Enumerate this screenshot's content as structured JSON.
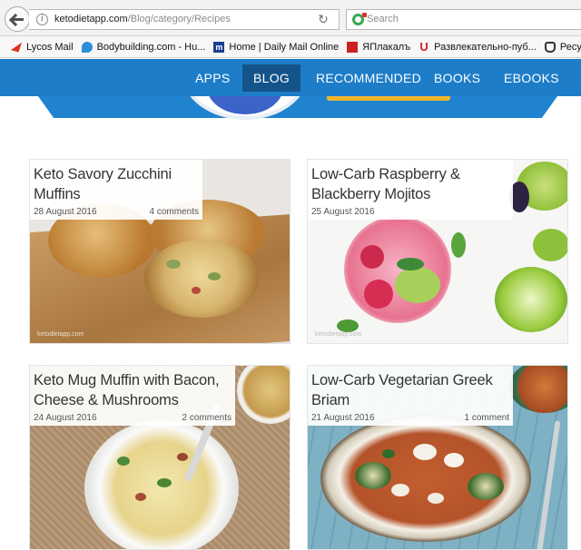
{
  "browser": {
    "url_domain": "ketodietapp.com",
    "url_path": "/Blog/category/Recipes",
    "search_placeholder": "Search",
    "bookmarks": [
      {
        "label": "Lycos Mail",
        "icon": "lycos-icon"
      },
      {
        "label": "Bodybuilding.com - Hu...",
        "icon": "bodybuilding-icon"
      },
      {
        "label": "Home | Daily Mail Online",
        "icon": "dailymail-icon"
      },
      {
        "label": "ЯПлакалъ",
        "icon": "yaplakal-icon"
      },
      {
        "label": "Развлекательно-пуб...",
        "icon": "u-icon"
      },
      {
        "label": "Ресурс Удава ",
        "icon": "hand-icon"
      }
    ]
  },
  "nav": {
    "items": [
      {
        "label": "APPS",
        "active": false
      },
      {
        "label": "BLOG",
        "active": true
      },
      {
        "label": "RECOMMENDED",
        "active": false
      },
      {
        "label": "BOOKS",
        "active": false
      },
      {
        "label": "EBOOKS",
        "active": false
      }
    ]
  },
  "colors": {
    "nav_bg": "#1d7dc8",
    "nav_active": "#14548a",
    "banner_button": "#f4b42a"
  },
  "posts": [
    {
      "title": "Keto Savory Zucchini Muffins",
      "date": "28 August 2016",
      "comments": "4 comments",
      "image": "muffins-photo"
    },
    {
      "title": "Low-Carb Raspberry & Blackberry Mojitos",
      "date": "25 August 2016",
      "comments": "",
      "image": "mojito-photo"
    },
    {
      "title": "Keto Mug Muffin with Bacon, Cheese & Mushrooms",
      "date": "24 August 2016",
      "comments": "2 comments",
      "image": "mug-muffin-photo"
    },
    {
      "title": "Low-Carb Vegetarian Greek Briam",
      "date": "21 August 2016",
      "comments": "1 comment",
      "image": "briam-photo"
    }
  ]
}
